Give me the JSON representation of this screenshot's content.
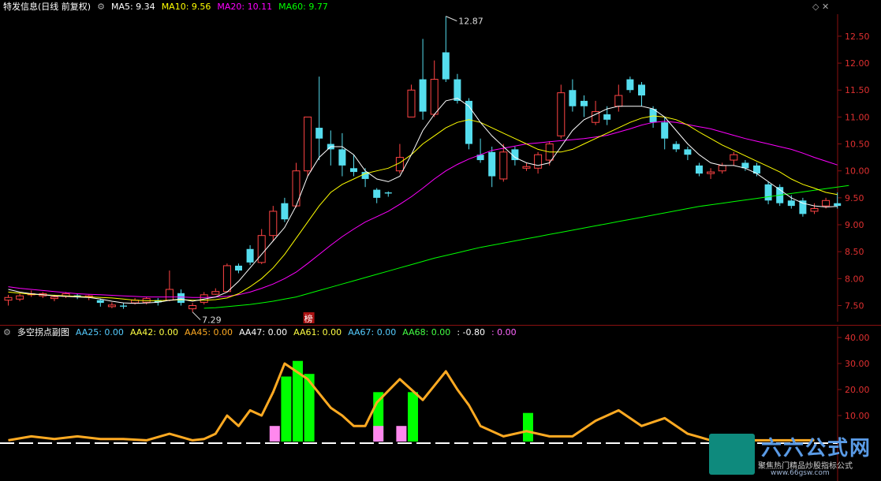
{
  "header": {
    "title": "特发信息(日线 前复权)",
    "ma": [
      {
        "label": "MA5: 9.34",
        "color": "#ffffff"
      },
      {
        "label": "MA10: 9.56",
        "color": "#ffff00"
      },
      {
        "label": "MA20: 10.11",
        "color": "#ff00ff"
      },
      {
        "label": "MA60: 9.77",
        "color": "#00ff00"
      }
    ],
    "corner_icons": "◇ ✕"
  },
  "sub_header": {
    "title": "多空拐点副图",
    "items": [
      {
        "label": "AA25: 0.00",
        "color": "#55ccff"
      },
      {
        "label": "AA42: 0.00",
        "color": "#ffff44"
      },
      {
        "label": "AA45: 0.00",
        "color": "#ffaa22"
      },
      {
        "label": "AA47: 0.00",
        "color": "#ffffff"
      },
      {
        "label": "AA61: 0.00",
        "color": "#ffff44"
      },
      {
        "label": "AA67: 0.00",
        "color": "#55ccff"
      },
      {
        "label": "AA68: 0.00",
        "color": "#44ff44"
      },
      {
        "label": ": -0.80",
        "color": "#ffffff"
      },
      {
        "label": ": 0.00",
        "color": "#ff66ff"
      }
    ]
  },
  "watermark": {
    "main": "六六公式网",
    "sub": "聚焦热门精品炒股指标公式",
    "url": "www.66gsw.com"
  },
  "chart_data": [
    {
      "type": "candlestick",
      "title": "特发信息(日线 前复权)",
      "y_ticks": [
        "12.50",
        "12.00",
        "11.50",
        "11.00",
        "10.50",
        "10.00",
        "9.50",
        "9.00",
        "8.50",
        "8.00",
        "7.50"
      ],
      "ylim": [
        7.2,
        12.85
      ],
      "annotations": [
        {
          "text": "12.87",
          "kind": "high"
        },
        {
          "text": "7.29",
          "kind": "low"
        },
        {
          "text": "榜",
          "kind": "marker"
        }
      ],
      "colors": {
        "up": "#ff4444",
        "down": "#55ddee"
      },
      "candles": [
        [
          7.6,
          7.65,
          7.5,
          7.7
        ],
        [
          7.62,
          7.68,
          7.58,
          7.72
        ],
        [
          7.7,
          7.72,
          7.66,
          7.78
        ],
        [
          7.68,
          7.72,
          7.64,
          7.75
        ],
        [
          7.63,
          7.66,
          7.58,
          7.7
        ],
        [
          7.67,
          7.72,
          7.64,
          7.75
        ],
        [
          7.69,
          7.66,
          7.62,
          7.72
        ],
        [
          7.66,
          7.68,
          7.6,
          7.7
        ],
        [
          7.6,
          7.55,
          7.48,
          7.63
        ],
        [
          7.48,
          7.51,
          7.45,
          7.56
        ],
        [
          7.5,
          7.48,
          7.44,
          7.55
        ],
        [
          7.55,
          7.6,
          7.52,
          7.64
        ],
        [
          7.56,
          7.63,
          7.52,
          7.66
        ],
        [
          7.6,
          7.56,
          7.5,
          7.64
        ],
        [
          7.6,
          7.8,
          7.58,
          8.15
        ],
        [
          7.73,
          7.55,
          7.5,
          7.8
        ],
        [
          7.44,
          7.5,
          7.38,
          7.55
        ],
        [
          7.56,
          7.7,
          7.52,
          7.75
        ],
        [
          7.71,
          7.76,
          7.7,
          7.82
        ],
        [
          7.76,
          8.24,
          7.75,
          8.28
        ],
        [
          8.24,
          8.15,
          8.1,
          8.28
        ],
        [
          8.55,
          8.3,
          8.25,
          8.62
        ],
        [
          8.3,
          8.8,
          8.27,
          8.92
        ],
        [
          8.8,
          9.25,
          8.7,
          9.35
        ],
        [
          9.4,
          9.1,
          9.05,
          9.5
        ],
        [
          9.35,
          10.0,
          9.32,
          10.15
        ],
        [
          10.0,
          11.0,
          9.9,
          11.0
        ],
        [
          10.8,
          10.6,
          10.2,
          11.75
        ],
        [
          10.5,
          10.4,
          10.1,
          10.75
        ],
        [
          10.4,
          10.1,
          9.9,
          10.7
        ],
        [
          10.05,
          9.98,
          9.9,
          10.3
        ],
        [
          9.98,
          9.85,
          9.7,
          10.05
        ],
        [
          9.65,
          9.5,
          9.4,
          9.68
        ],
        [
          9.6,
          9.58,
          9.52,
          9.62
        ],
        [
          10.0,
          10.25,
          9.95,
          10.5
        ],
        [
          11.0,
          11.5,
          11.0,
          11.6
        ],
        [
          11.7,
          11.1,
          10.95,
          12.45
        ],
        [
          11.05,
          11.7,
          11.0,
          12.05
        ],
        [
          12.2,
          11.7,
          11.65,
          12.87
        ],
        [
          11.7,
          11.3,
          11.25,
          11.8
        ],
        [
          11.3,
          10.5,
          10.4,
          11.35
        ],
        [
          10.3,
          10.2,
          10.15,
          10.6
        ],
        [
          10.35,
          9.9,
          9.7,
          10.45
        ],
        [
          9.85,
          10.35,
          9.8,
          10.5
        ],
        [
          10.4,
          10.2,
          10.1,
          10.45
        ],
        [
          10.05,
          10.08,
          10.0,
          10.15
        ],
        [
          10.05,
          10.3,
          9.95,
          10.35
        ],
        [
          10.2,
          10.5,
          10.1,
          10.55
        ],
        [
          10.65,
          11.45,
          10.6,
          11.6
        ],
        [
          11.5,
          11.2,
          11.1,
          11.7
        ],
        [
          11.3,
          11.2,
          11.0,
          11.4
        ],
        [
          10.9,
          11.1,
          10.85,
          11.3
        ],
        [
          11.05,
          10.95,
          10.85,
          11.2
        ],
        [
          11.2,
          11.4,
          11.1,
          11.6
        ],
        [
          11.7,
          11.5,
          11.45,
          11.75
        ],
        [
          11.6,
          11.4,
          11.2,
          11.65
        ],
        [
          11.15,
          10.9,
          10.8,
          11.2
        ],
        [
          10.9,
          10.6,
          10.4,
          11.0
        ],
        [
          10.5,
          10.4,
          10.35,
          10.55
        ],
        [
          10.4,
          10.3,
          10.2,
          10.45
        ],
        [
          10.1,
          9.95,
          9.9,
          10.15
        ],
        [
          9.95,
          9.98,
          9.85,
          10.05
        ],
        [
          10.0,
          10.1,
          9.95,
          10.15
        ],
        [
          10.2,
          10.3,
          10.1,
          10.35
        ],
        [
          10.15,
          10.05,
          10.0,
          10.2
        ],
        [
          10.1,
          9.95,
          9.9,
          10.15
        ],
        [
          9.75,
          9.45,
          9.38,
          9.8
        ],
        [
          9.7,
          9.4,
          9.35,
          9.75
        ],
        [
          9.45,
          9.35,
          9.3,
          9.55
        ],
        [
          9.45,
          9.2,
          9.15,
          9.5
        ],
        [
          9.25,
          9.3,
          9.2,
          9.4
        ],
        [
          9.35,
          9.45,
          9.3,
          9.5
        ],
        [
          9.4,
          9.35,
          9.3,
          9.6
        ]
      ],
      "ma5": [
        7.8,
        7.75,
        7.72,
        7.7,
        7.68,
        7.67,
        7.66,
        7.65,
        7.62,
        7.58,
        7.55,
        7.54,
        7.55,
        7.56,
        7.6,
        7.62,
        7.58,
        7.62,
        7.66,
        7.75,
        7.95,
        8.2,
        8.45,
        8.7,
        8.95,
        9.35,
        9.9,
        10.25,
        10.45,
        10.45,
        10.3,
        10.0,
        9.85,
        9.8,
        9.9,
        10.3,
        10.75,
        11.05,
        11.3,
        11.35,
        11.2,
        10.9,
        10.65,
        10.45,
        10.25,
        10.15,
        10.1,
        10.15,
        10.45,
        10.75,
        10.95,
        11.05,
        11.15,
        11.2,
        11.2,
        11.2,
        11.15,
        11.0,
        10.75,
        10.5,
        10.3,
        10.15,
        10.1,
        10.1,
        10.05,
        9.95,
        9.8,
        9.65,
        9.5,
        9.4,
        9.35,
        9.33,
        9.34
      ],
      "ma10": [
        7.75,
        7.73,
        7.71,
        7.7,
        7.69,
        7.68,
        7.67,
        7.66,
        7.65,
        7.64,
        7.62,
        7.6,
        7.59,
        7.59,
        7.6,
        7.61,
        7.6,
        7.6,
        7.61,
        7.64,
        7.72,
        7.85,
        8.0,
        8.2,
        8.45,
        8.75,
        9.05,
        9.35,
        9.6,
        9.75,
        9.85,
        9.95,
        10.0,
        10.05,
        10.15,
        10.3,
        10.5,
        10.65,
        10.8,
        10.9,
        10.95,
        10.9,
        10.8,
        10.7,
        10.6,
        10.5,
        10.4,
        10.35,
        10.35,
        10.4,
        10.5,
        10.6,
        10.7,
        10.8,
        10.9,
        10.98,
        11.02,
        11.0,
        10.95,
        10.85,
        10.72,
        10.6,
        10.48,
        10.38,
        10.28,
        10.18,
        10.08,
        9.98,
        9.85,
        9.75,
        9.68,
        9.6,
        9.56
      ],
      "ma20": [
        7.85,
        7.82,
        7.8,
        7.78,
        7.76,
        7.74,
        7.72,
        7.71,
        7.7,
        7.69,
        7.68,
        7.67,
        7.66,
        7.66,
        7.66,
        7.66,
        7.65,
        7.65,
        7.66,
        7.67,
        7.7,
        7.75,
        7.82,
        7.9,
        8.0,
        8.12,
        8.28,
        8.45,
        8.62,
        8.78,
        8.92,
        9.05,
        9.15,
        9.25,
        9.38,
        9.52,
        9.68,
        9.85,
        10.0,
        10.12,
        10.22,
        10.3,
        10.38,
        10.42,
        10.46,
        10.5,
        10.52,
        10.54,
        10.56,
        10.58,
        10.6,
        10.63,
        10.66,
        10.72,
        10.78,
        10.85,
        10.9,
        10.92,
        10.9,
        10.86,
        10.82,
        10.78,
        10.72,
        10.66,
        10.6,
        10.55,
        10.5,
        10.45,
        10.4,
        10.33,
        10.25,
        10.18,
        10.11
      ],
      "ma60_start_index": 17,
      "ma60": [
        7.45,
        7.46,
        7.48,
        7.5,
        7.52,
        7.55,
        7.58,
        7.62,
        7.66,
        7.72,
        7.78,
        7.84,
        7.9,
        7.96,
        8.02,
        8.08,
        8.14,
        8.2,
        8.26,
        8.32,
        8.38,
        8.43,
        8.48,
        8.53,
        8.58,
        8.62,
        8.66,
        8.7,
        8.74,
        8.78,
        8.82,
        8.86,
        8.9,
        8.94,
        8.98,
        9.02,
        9.06,
        9.1,
        9.14,
        9.18,
        9.22,
        9.26,
        9.3,
        9.34,
        9.37,
        9.4,
        9.43,
        9.46,
        9.49,
        9.52,
        9.55,
        9.58,
        9.61,
        9.64,
        9.67,
        9.7,
        9.73
      ]
    },
    {
      "type": "line",
      "title": "多空拐点副图",
      "y_ticks": [
        "40.00",
        "30.00",
        "20.00",
        "10.00"
      ],
      "ylim": [
        0,
        40
      ],
      "series": [
        {
          "key": "AA45",
          "color": "#ffaa22",
          "x": [
            0,
            2,
            4,
            6,
            8,
            10,
            12,
            14,
            16,
            17,
            18,
            19,
            20,
            21,
            22,
            23,
            24,
            26,
            28,
            29,
            30,
            31,
            32,
            34,
            36,
            38,
            39,
            40,
            41,
            43,
            45,
            47,
            49,
            51,
            53,
            55,
            57,
            59,
            61,
            63,
            65,
            67,
            70
          ],
          "values": [
            0.5,
            2,
            1,
            2,
            1,
            1,
            0.5,
            3,
            0.5,
            1,
            3,
            10,
            6,
            12,
            10,
            19,
            30,
            24,
            13,
            10,
            6,
            6,
            15,
            24,
            16,
            27,
            20,
            14,
            6,
            2,
            4,
            2,
            2,
            8,
            12,
            6,
            9,
            3,
            0.5,
            0.5,
            0.5,
            0.5,
            0.5
          ]
        }
      ],
      "bars": [
        {
          "x": 23,
          "top": 6,
          "color": "#ff88ee"
        },
        {
          "x": 24,
          "top": 25,
          "color": "#00ff00"
        },
        {
          "x": 25,
          "top": 31,
          "color": "#00ff00"
        },
        {
          "x": 26,
          "top": 26,
          "color": "#00ff00"
        },
        {
          "x": 32,
          "top": 19,
          "color": "#00ff00"
        },
        {
          "x": 32,
          "top": 6,
          "color": "#ff88ee"
        },
        {
          "x": 34,
          "top": 6,
          "color": "#ff88ee"
        },
        {
          "x": 35,
          "top": 19,
          "color": "#00ff00"
        },
        {
          "x": 45,
          "top": 11,
          "color": "#00ff00"
        }
      ]
    }
  ]
}
